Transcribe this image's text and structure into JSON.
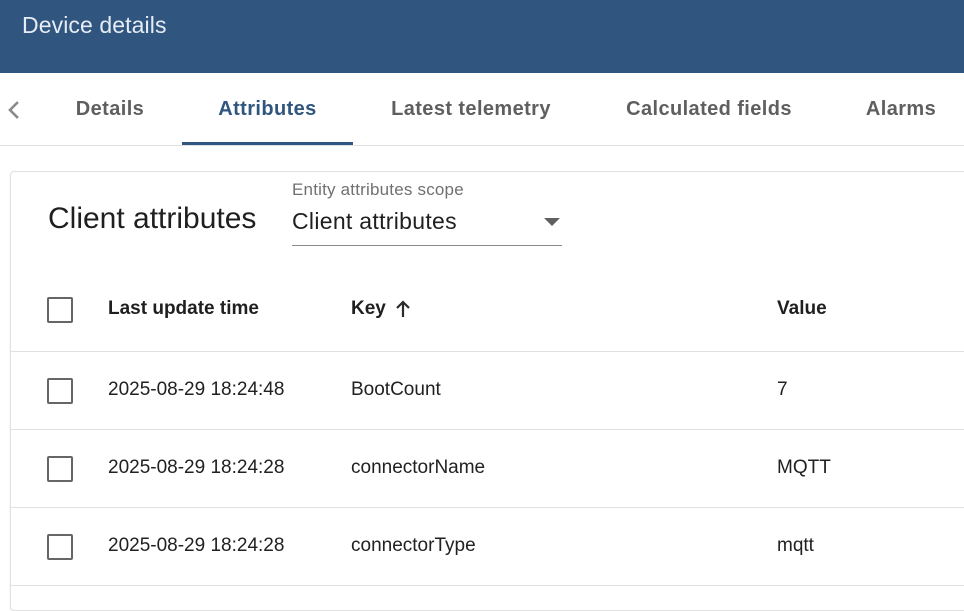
{
  "header": {
    "title": "Device details"
  },
  "tabs": {
    "prev_icon": "chevron-left-icon",
    "items": [
      {
        "label": "Details"
      },
      {
        "label": "Attributes"
      },
      {
        "label": "Latest telemetry"
      },
      {
        "label": "Calculated fields"
      },
      {
        "label": "Alarms"
      }
    ],
    "active": "Attributes"
  },
  "card": {
    "title": "Client attributes",
    "scope": {
      "label": "Entity attributes scope",
      "value": "Client attributes"
    }
  },
  "table": {
    "columns": {
      "time": "Last update time",
      "key": "Key",
      "value": "Value"
    },
    "sort": {
      "column": "Key",
      "direction": "ascending",
      "icon": "arrow-up-icon"
    },
    "rows": [
      {
        "time": "2025-08-29 18:24:48",
        "key": "BootCount",
        "value": "7"
      },
      {
        "time": "2025-08-29 18:24:28",
        "key": "connectorName",
        "value": "MQTT"
      },
      {
        "time": "2025-08-29 18:24:28",
        "key": "connectorType",
        "value": "mqtt"
      }
    ]
  },
  "colors": {
    "primary": "#305680",
    "tab_inactive": "#5f5f5f",
    "divider": "#e0e0e0"
  }
}
